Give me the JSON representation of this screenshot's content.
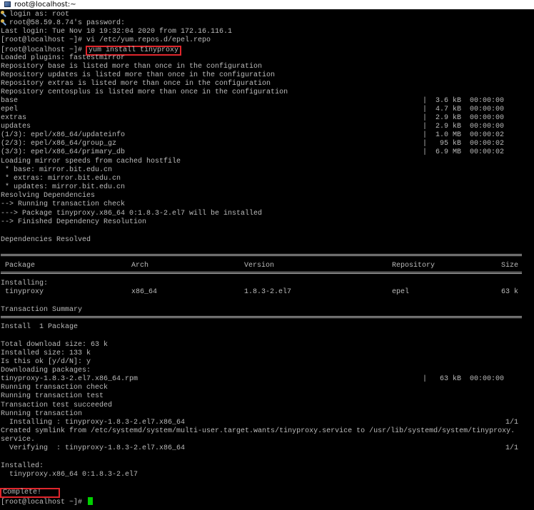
{
  "window": {
    "title": "root@localhost:~"
  },
  "terminal": {
    "login_prompt": "login as: root",
    "password_prompt": "root@58.59.8.74's password:",
    "last_login": "Last login: Tue Nov 10 19:32:04 2020 from 172.16.116.1",
    "cmd1_prompt": "[root@localhost ~]# ",
    "cmd1": "vi /etc/yum.repos.d/epel.repo",
    "cmd2_prompt": "[root@localhost ~]# ",
    "cmd2": "yum install tinyproxy",
    "plugins": "Loaded plugins: fastestmirror",
    "repo_warnings": [
      "Repository base is listed more than once in the configuration",
      "Repository updates is listed more than once in the configuration",
      "Repository extras is listed more than once in the configuration",
      "Repository centosplus is listed more than once in the configuration"
    ],
    "downloads": [
      {
        "name": "base",
        "size": "|  3.6 kB  00:00:00"
      },
      {
        "name": "epel",
        "size": "|  4.7 kB  00:00:00"
      },
      {
        "name": "extras",
        "size": "|  2.9 kB  00:00:00"
      },
      {
        "name": "updates",
        "size": "|  2.9 kB  00:00:00"
      },
      {
        "name": "(1/3): epel/x86_64/updateinfo",
        "size": "|  1.0 MB  00:00:02"
      },
      {
        "name": "(2/3): epel/x86_64/group_gz",
        "size": "|   95 kB  00:00:02"
      },
      {
        "name": "(3/3): epel/x86_64/primary_db",
        "size": "|  6.9 MB  00:00:02"
      }
    ],
    "mirror_lines": [
      "Loading mirror speeds from cached hostfile",
      " * base: mirror.bit.edu.cn",
      " * extras: mirror.bit.edu.cn",
      " * updates: mirror.bit.edu.cn",
      "Resolving Dependencies",
      "--> Running transaction check",
      "---> Package tinyproxy.x86_64 0:1.8.3-2.el7 will be installed",
      "--> Finished Dependency Resolution"
    ],
    "deps_resolved": "Dependencies Resolved",
    "table": {
      "headers": {
        "package": " Package",
        "arch": "Arch",
        "version": "Version",
        "repository": "Repository",
        "size": "Size"
      },
      "installing_label": "Installing:",
      "row": {
        "package": " tinyproxy",
        "arch": "x86_64",
        "version": "1.8.3-2.el7",
        "repository": "epel",
        "size": "63 k"
      }
    },
    "transaction_summary": "Transaction Summary",
    "install_count": "Install  1 Package",
    "post_lines": [
      "Total download size: 63 k",
      "Installed size: 133 k",
      "Is this ok [y/d/N]: y",
      "Downloading packages:"
    ],
    "rpm_file": "tinyproxy-1.8.3-2.el7.x86_64.rpm",
    "rpm_size": "|   63 kB  00:00:00",
    "run_lines": [
      "Running transaction check",
      "Running transaction test",
      "Transaction test succeeded",
      "Running transaction"
    ],
    "installing_pkg": "  Installing : tinyproxy-1.8.3-2.el7.x86_64",
    "installing_progress": "1/1",
    "symlink_line1": "Created symlink from /etc/systemd/system/multi-user.target.wants/tinyproxy.service to /usr/lib/systemd/system/tinyproxy.",
    "symlink_line2": "service.",
    "verifying_pkg": "  Verifying  : tinyproxy-1.8.3-2.el7.x86_64",
    "verifying_progress": "1/1",
    "installed_label": "Installed:",
    "installed_pkg": "  tinyproxy.x86_64 0:1.8.3-2.el7",
    "complete": "Complete!",
    "final_prompt": "[root@localhost ~]# "
  },
  "colors": {
    "highlight": "#e0262c",
    "cursor": "#00d000",
    "text": "#bbbbbb"
  }
}
